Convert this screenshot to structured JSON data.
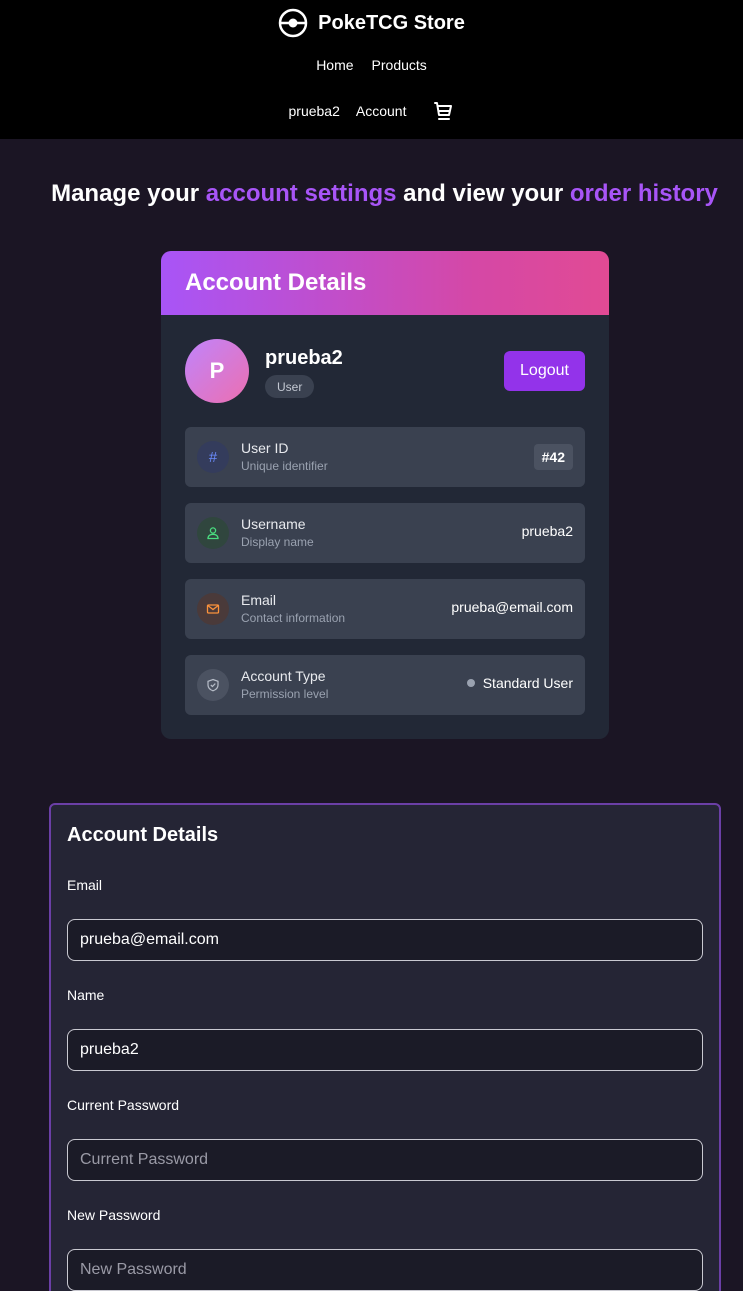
{
  "header": {
    "brand": "PokeTCG Store",
    "nav": [
      "Home",
      "Products"
    ],
    "user_link": "prueba2",
    "account_link": "Account"
  },
  "hero": {
    "part1": "Manage your ",
    "accent1": "account settings",
    "part2": " and view your ",
    "accent2": "order history",
    "accent_color": "#a855f7"
  },
  "card": {
    "title": "Account Details",
    "avatar_initial": "P",
    "username": "prueba2",
    "role": "User",
    "logout_label": "Logout",
    "rows": [
      {
        "label": "User ID",
        "sub": "Unique identifier",
        "value": "#42",
        "icon": "hash-icon"
      },
      {
        "label": "Username",
        "sub": "Display name",
        "value": "prueba2",
        "icon": "user-icon"
      },
      {
        "label": "Email",
        "sub": "Contact information",
        "value": "prueba@email.com",
        "icon": "mail-icon"
      },
      {
        "label": "Account Type",
        "sub": "Permission level",
        "value": "Standard User",
        "icon": "shield-icon"
      }
    ]
  },
  "form": {
    "title": "Account Details",
    "email_label": "Email",
    "email_value": "prueba@email.com",
    "name_label": "Name",
    "name_value": "prueba2",
    "current_password_label": "Current Password",
    "current_password_placeholder": "Current Password",
    "new_password_label": "New Password",
    "new_password_placeholder": "New Password"
  },
  "colors": {
    "background": "#1b1524",
    "header": "#000000",
    "accent": "#9333ea",
    "card": "#222836"
  }
}
